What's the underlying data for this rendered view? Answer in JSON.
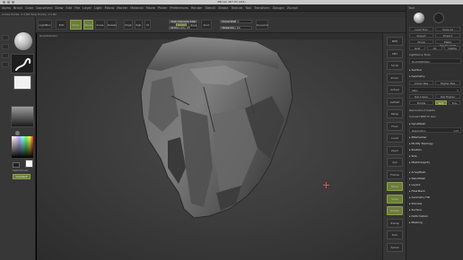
{
  "window": {
    "title": "ZBrush 4R7 P3 (x64)"
  },
  "menu": [
    "Alpha",
    "Brush",
    "Color",
    "Document",
    "Draw",
    "Edit",
    "File",
    "Layer",
    "Light",
    "Macro",
    "Marker",
    "Material",
    "Movie",
    "Picker",
    "Preferences",
    "Render",
    "Stencil",
    "Stroke",
    "Texture",
    "Tool",
    "Transform",
    "Zplugin",
    "Zscript"
  ],
  "status_text": "Active Points: 2.3 Mil   Total Points: 2.3 Mil",
  "toolbar": {
    "lightbox": "LightBox",
    "edit": "Edit",
    "draw": "Draw",
    "move": "Move",
    "scale": "Scale",
    "rotate": "Rotate",
    "mrgb": "Mrgb",
    "rgb": "Rgb",
    "m": "M",
    "zadd": "Zadd",
    "zsub": "Zsub",
    "zcut": "Zcut",
    "focal_shift": "Focal Shift 0",
    "draw_size": "Draw Size 64",
    "rgb_intensity": "Rgb Intensity 100",
    "z_intensity": "Z Intensity 25",
    "dynamic": "Dynamic"
  },
  "left_shelf": {
    "switch_color": "SwitchColor",
    "gradient": "Gradient"
  },
  "canvas": {
    "tool_name": "RockWithSkin"
  },
  "right_shelf": [
    "BPR",
    "SPix",
    "Scroll",
    "Zoom",
    "Actual",
    "AAHalf",
    "Persp",
    "Floor",
    "Local",
    "LSym",
    "Xyz",
    "Frame",
    "Move",
    "Scale",
    "Rotate",
    "Transp",
    "Solo",
    "Xpose"
  ],
  "tray": {
    "header": "Tool",
    "load_tool": "Load Tool",
    "save_as": "Save As",
    "import": "Import",
    "export": "Export",
    "clone": "Clone",
    "make_polymesh3d": "Make PolyMesh3D",
    "goz": "GoZ",
    "all": "All",
    "visible": "Visible",
    "lightbox_tools": "Lightbox ▸ Tools",
    "current_tool": "RockWithSkin",
    "subtool": "SubTool",
    "geometry": "Geometry",
    "sdiv_label": "SDiv",
    "sdiv_value": "5",
    "lower_res": "Lower Res",
    "higher_res": "Higher Res",
    "del_lower": "Del Lower",
    "del_higher": "Del Higher",
    "divide": "Divide",
    "smt": "Smt",
    "suv": "Suv",
    "reconstruct": "Reconstruct Subdiv",
    "convert_bpr": "Convert BPR To Geo",
    "dynamesh": "DynaMesh",
    "resolution_label": "Resolution",
    "resolution_value": "128",
    "zremesher": "ZRemesher",
    "modify_topology": "Modify Topology",
    "position": "Position",
    "size": "Size",
    "meshintegrity": "MeshIntegrity",
    "arraymesh": "ArrayMesh",
    "nanomesh": "NanoMesh",
    "layers": "Layers",
    "fibermesh": "FiberMesh",
    "geometry_hd": "Geometry HD",
    "preview": "Preview",
    "surface": "Surface",
    "deformation": "Deformation",
    "masking": "Masking"
  },
  "colors": {
    "accent": "#6a7d3a",
    "canvas": "#3a3a3a",
    "panel": "#353535"
  },
  "icons": [
    "sphere-brush-icon",
    "stroke-icon",
    "alpha-icon",
    "texture-icon",
    "color-picker-icon",
    "cursor-crosshair-icon",
    "rock-model"
  ]
}
